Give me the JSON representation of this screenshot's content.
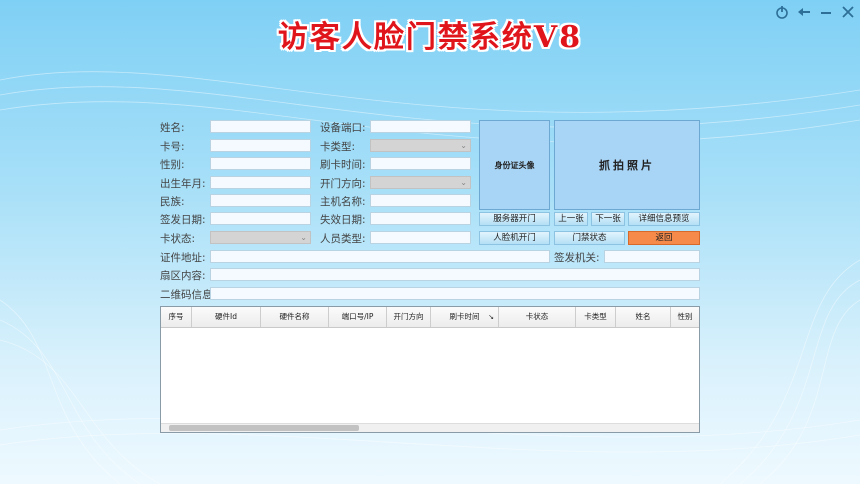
{
  "title": "访客人脸门禁系统V8",
  "window_controls": [
    "power-icon",
    "back-icon",
    "minimize-icon",
    "close-icon"
  ],
  "form": {
    "name_label": "姓名:",
    "card_no_label": "卡号:",
    "gender_label": "性别:",
    "birth_label": "出生年月:",
    "ethnicity_label": "民族:",
    "issue_date_label": "签发日期:",
    "card_status_label": "卡状态:",
    "device_port_label": "设备端口:",
    "card_type_label": "卡类型:",
    "swipe_time_label": "刷卡时间:",
    "door_dir_label": "开门方向:",
    "host_name_label": "主机名称:",
    "expire_date_label": "失效日期:",
    "person_type_label": "人员类型:",
    "address_label": "证件地址:",
    "issuer_label": "签发机关:",
    "sector_label": "扇区内容:",
    "qrcode_label": "二维码信息"
  },
  "photos": {
    "id_photo": "身份证头像",
    "capture_photo": "抓拍照片"
  },
  "buttons": {
    "server_open": "服务器开门",
    "prev": "上一张",
    "next": "下一张",
    "detail_preview": "详细信息预览",
    "face_open": "人脸机开门",
    "door_status": "门禁状态",
    "back": "返回"
  },
  "colors": {
    "title": "#e0141b",
    "back_button": "#f58a4a",
    "photo_bg": "#a8d4f5"
  },
  "table": {
    "columns": [
      "序号",
      "硬件Id",
      "硬件名称",
      "端口号/IP",
      "开门方向",
      "刷卡时间",
      "卡状态",
      "卡类型",
      "姓名",
      "性别"
    ],
    "sort_indicator": "↘",
    "rows": []
  }
}
